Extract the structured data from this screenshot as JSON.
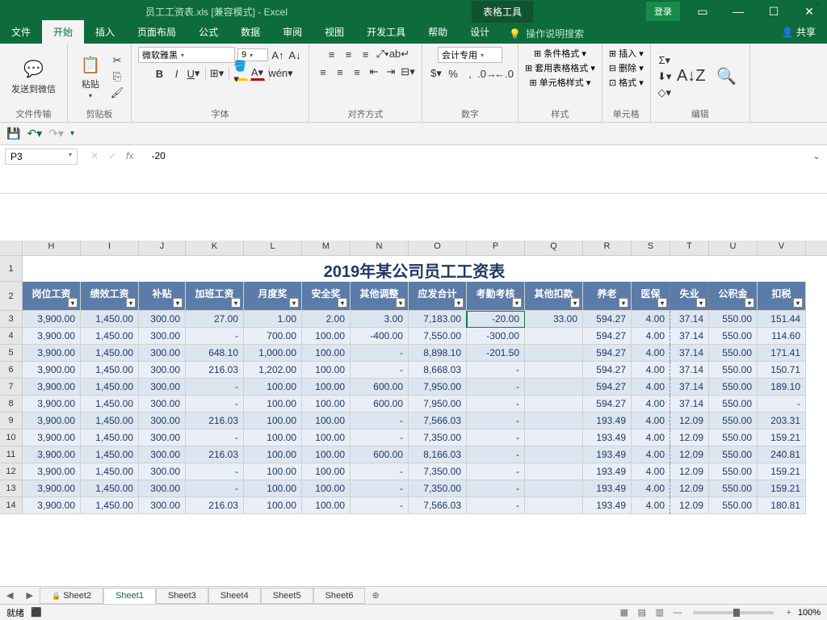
{
  "title": "员工工资表.xls  [兼容模式]  -  Excel",
  "table_tools": "表格工具",
  "login": "登录",
  "tabs": [
    "文件",
    "开始",
    "插入",
    "页面布局",
    "公式",
    "数据",
    "审阅",
    "视图",
    "开发工具",
    "帮助",
    "设计"
  ],
  "help_prompt": "操作说明搜索",
  "share": "共享",
  "ribbon": {
    "g1": {
      "name": "文件传输",
      "btn": "发送到微信"
    },
    "g2": {
      "name": "剪贴板",
      "btn": "粘贴"
    },
    "g3": {
      "name": "字体",
      "font": "微软雅黑",
      "size": "9"
    },
    "g4": {
      "name": "对齐方式"
    },
    "g5": {
      "name": "数字",
      "format": "会计专用"
    },
    "g6": {
      "name": "样式",
      "a": "条件格式",
      "b": "套用表格格式",
      "c": "单元格样式"
    },
    "g7": {
      "name": "单元格",
      "a": "插入",
      "b": "删除",
      "c": "格式"
    },
    "g8": {
      "name": "编辑"
    }
  },
  "namebox": "P3",
  "formula": "-20",
  "sheet_title": "2019年某公司员工工资表",
  "columns": [
    "H",
    "I",
    "J",
    "K",
    "L",
    "M",
    "N",
    "O",
    "P",
    "Q",
    "R",
    "S",
    "T",
    "U",
    "V"
  ],
  "col_widths": [
    "cH",
    "cI",
    "cJ",
    "cK",
    "cL",
    "cM",
    "cN",
    "cO",
    "cP",
    "cQ",
    "cR",
    "cS",
    "cT",
    "cU",
    "cV"
  ],
  "headers": [
    "岗位工资",
    "绩效工资",
    "补贴",
    "加班工资",
    "月度奖",
    "安全奖",
    "其他调整",
    "应发合计",
    "考勤考核",
    "其他扣款",
    "养老",
    "医保",
    "失业",
    "公积金",
    "扣税"
  ],
  "chart_data": {
    "type": "table",
    "columns": [
      "岗位工资",
      "绩效工资",
      "补贴",
      "加班工资",
      "月度奖",
      "安全奖",
      "其他调整",
      "应发合计",
      "考勤考核",
      "其他扣款",
      "养老",
      "医保",
      "失业",
      "公积金",
      "扣税"
    ],
    "rows": [
      [
        "3,900.00",
        "1,450.00",
        "300.00",
        "27.00",
        "1.00",
        "2.00",
        "3.00",
        "7,183.00",
        "-20.00",
        "33.00",
        "594.27",
        "4.00",
        "37.14",
        "550.00",
        "151.44"
      ],
      [
        "3,900.00",
        "1,450.00",
        "300.00",
        "-",
        "700.00",
        "100.00",
        "-400.00",
        "7,550.00",
        "-300.00",
        "",
        "594.27",
        "4.00",
        "37.14",
        "550.00",
        "114.60"
      ],
      [
        "3,900.00",
        "1,450.00",
        "300.00",
        "648.10",
        "1,000.00",
        "100.00",
        "-",
        "8,898.10",
        "-201.50",
        "",
        "594.27",
        "4.00",
        "37.14",
        "550.00",
        "171.41"
      ],
      [
        "3,900.00",
        "1,450.00",
        "300.00",
        "216.03",
        "1,202.00",
        "100.00",
        "-",
        "8,668.03",
        "-",
        "",
        "594.27",
        "4.00",
        "37.14",
        "550.00",
        "150.71"
      ],
      [
        "3,900.00",
        "1,450.00",
        "300.00",
        "-",
        "100.00",
        "100.00",
        "600.00",
        "7,950.00",
        "-",
        "",
        "594.27",
        "4.00",
        "37.14",
        "550.00",
        "189.10"
      ],
      [
        "3,900.00",
        "1,450.00",
        "300.00",
        "-",
        "100.00",
        "100.00",
        "600.00",
        "7,950.00",
        "-",
        "",
        "594.27",
        "4.00",
        "37.14",
        "550.00",
        "-"
      ],
      [
        "3,900.00",
        "1,450.00",
        "300.00",
        "216.03",
        "100.00",
        "100.00",
        "-",
        "7,566.03",
        "-",
        "",
        "193.49",
        "4.00",
        "12.09",
        "550.00",
        "203.31"
      ],
      [
        "3,900.00",
        "1,450.00",
        "300.00",
        "-",
        "100.00",
        "100.00",
        "-",
        "7,350.00",
        "-",
        "",
        "193.49",
        "4.00",
        "12.09",
        "550.00",
        "159.21"
      ],
      [
        "3,900.00",
        "1,450.00",
        "300.00",
        "216.03",
        "100.00",
        "100.00",
        "600.00",
        "8,166.03",
        "-",
        "",
        "193.49",
        "4.00",
        "12.09",
        "550.00",
        "240.81"
      ],
      [
        "3,900.00",
        "1,450.00",
        "300.00",
        "-",
        "100.00",
        "100.00",
        "-",
        "7,350.00",
        "-",
        "",
        "193.49",
        "4.00",
        "12.09",
        "550.00",
        "159.21"
      ],
      [
        "3,900.00",
        "1,450.00",
        "300.00",
        "-",
        "100.00",
        "100.00",
        "-",
        "7,350.00",
        "-",
        "",
        "193.49",
        "4.00",
        "12.09",
        "550.00",
        "159.21"
      ],
      [
        "3,900.00",
        "1,450.00",
        "300.00",
        "216.03",
        "100.00",
        "100.00",
        "-",
        "7,566.03",
        "-",
        "",
        "193.49",
        "4.00",
        "12.09",
        "550.00",
        "180.81"
      ]
    ]
  },
  "sheets": [
    "Sheet2",
    "Sheet1",
    "Sheet3",
    "Sheet4",
    "Sheet5",
    "Sheet6"
  ],
  "active_sheet": 1,
  "status": "就绪",
  "zoom": "100%"
}
